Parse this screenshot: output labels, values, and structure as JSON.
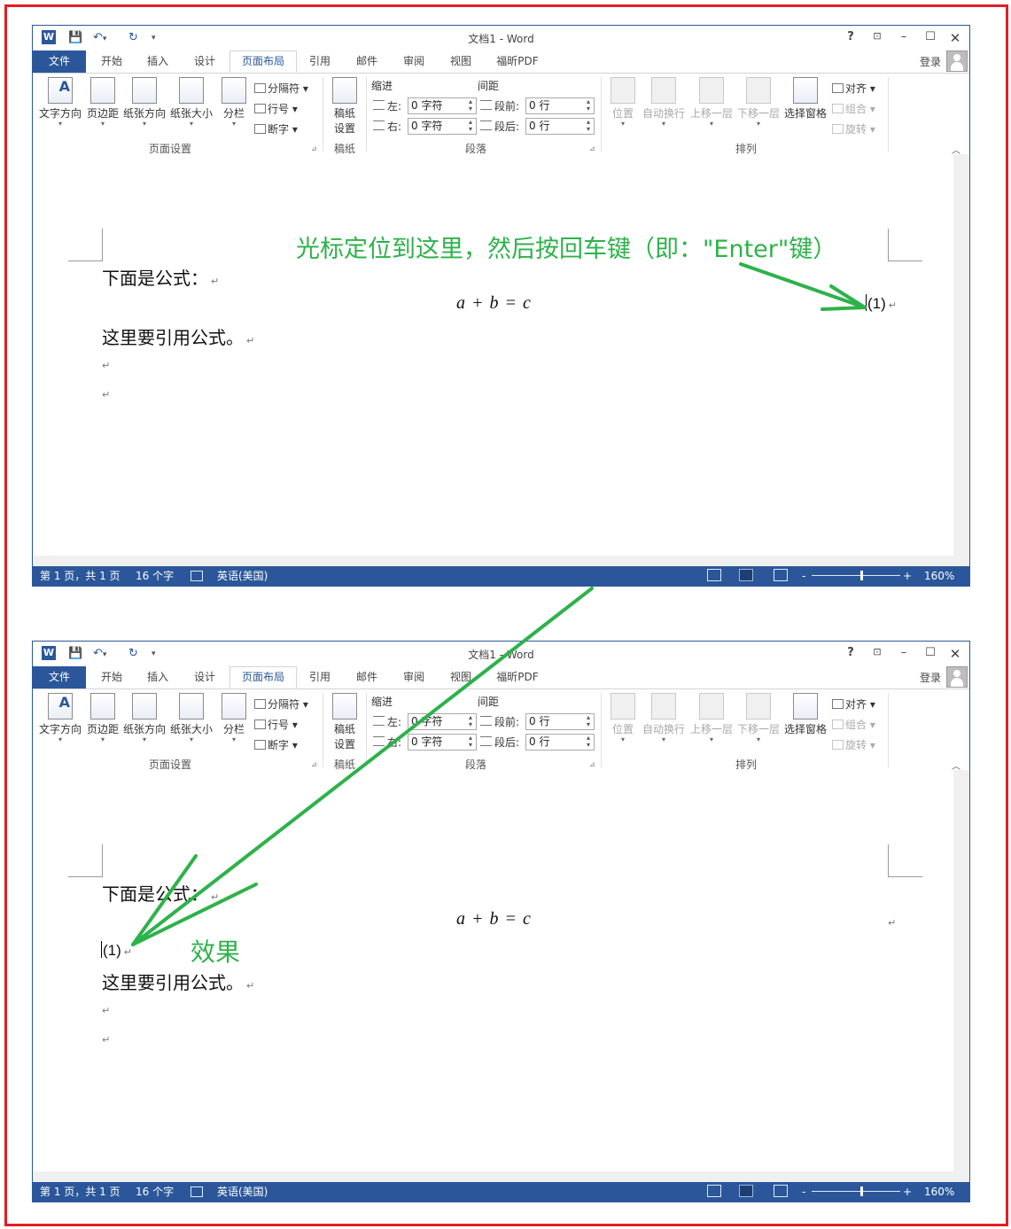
{
  "windows": [
    {
      "id": "before",
      "quick_access": {
        "word_icon": "W",
        "save": "💾",
        "undo": "↶",
        "undo_dd": "▾",
        "redo": "↻",
        "more": "▾"
      },
      "title": "文档1 - Word",
      "window_buttons": {
        "help": "?",
        "ribbon_display": "⊡",
        "minimize": "–",
        "maximize": "☐",
        "close": "✕"
      },
      "tabs": [
        "文件",
        "开始",
        "插入",
        "设计",
        "页面布局",
        "引用",
        "邮件",
        "审阅",
        "视图",
        "福昕PDF"
      ],
      "active_tab": "页面布局",
      "login": "登录",
      "ribbon": {
        "page_setup": {
          "text_direction": "文字方向",
          "margins": "页边距",
          "orientation": "纸张方向",
          "size": "纸张大小",
          "columns": "分栏",
          "breaks": "分隔符 ▾",
          "line_numbers": "行号 ▾",
          "hyphenation": "断字 ▾",
          "label": "页面设置"
        },
        "draft": {
          "draft_setup_1": "稿纸",
          "draft_setup_2": "设置",
          "label": "稿纸"
        },
        "paragraph": {
          "indent": "缩进",
          "spacing": "间距",
          "left": "左:",
          "right": "右:",
          "before": "段前:",
          "after": "段后:",
          "left_value": "0 字符",
          "right_value": "0 字符",
          "before_value": "0 行",
          "after_value": "0 行",
          "label": "段落"
        },
        "arrange": {
          "position": "位置",
          "wrap": "自动换行",
          "forward": "上移一层",
          "backward": "下移一层",
          "pane": "选择窗格",
          "align": "对齐 ▾",
          "group": "组合 ▾",
          "rotate": "旋转 ▾",
          "label": "排列"
        },
        "launcher": "⊿",
        "collapse": "︿",
        "dropdown": "▾"
      },
      "document": {
        "line1": "下面是公式：",
        "equation": "a + b = c",
        "eq_number": "(1)",
        "line2": "这里要引用公式。",
        "para_mark": "↵"
      },
      "status": {
        "page": "第 1 页，共 1 页",
        "words": "16 个字",
        "lang": "英语(美国)",
        "zoom": "160%",
        "zoom_minus": "-",
        "zoom_plus": "+"
      }
    },
    {
      "id": "after",
      "title": "文档1 - Word",
      "document": {
        "line1": "下面是公式：",
        "equation": "a + b = c",
        "eq_number": "(1)",
        "line2": "这里要引用公式。",
        "para_mark": "↵"
      },
      "status": {
        "page": "第 1 页，共 1 页",
        "words": "16 个字",
        "lang": "英语(美国)",
        "zoom": "160%"
      }
    }
  ],
  "annotations": {
    "instruction": "光标定位到这里，然后按回车键（即：\"Enter\"键）",
    "result": "效果",
    "color": "#2db24a"
  },
  "frame_color": "#e31e24",
  "accent": "#2b579a"
}
